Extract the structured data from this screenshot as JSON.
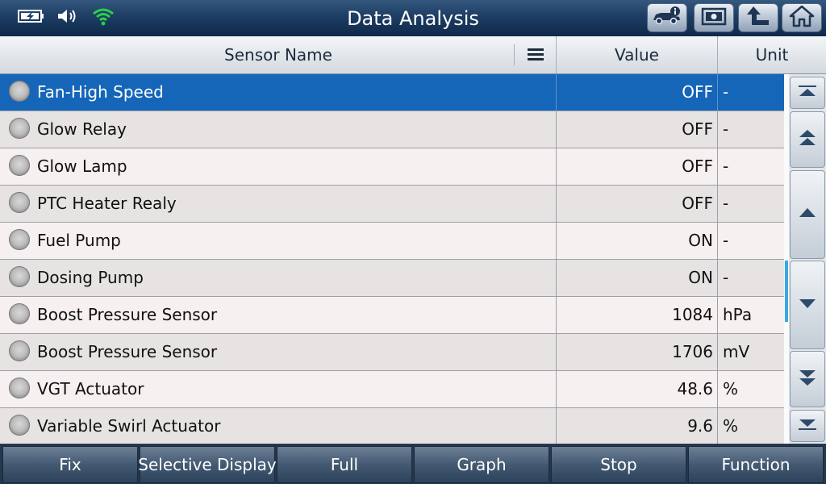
{
  "title": "Data Analysis",
  "status_icons": [
    "battery-charging-icon",
    "speaker-icon",
    "wifi-icon"
  ],
  "toolbar_icons": [
    "vehicle-info-icon",
    "screenshot-icon",
    "back-arrow-icon",
    "home-icon"
  ],
  "header": {
    "sensor_name": "Sensor Name",
    "value": "Value",
    "unit": "Unit",
    "menu_icon": "list-menu-icon"
  },
  "rows": [
    {
      "name": "Fan-High Speed",
      "value": "OFF",
      "unit": "-",
      "selected": true
    },
    {
      "name": "Glow Relay",
      "value": "OFF",
      "unit": "-"
    },
    {
      "name": "Glow Lamp",
      "value": "OFF",
      "unit": "-"
    },
    {
      "name": "PTC Heater Realy",
      "value": "OFF",
      "unit": "-"
    },
    {
      "name": "Fuel Pump",
      "value": "ON",
      "unit": "-"
    },
    {
      "name": "Dosing Pump",
      "value": "ON",
      "unit": "-"
    },
    {
      "name": "Boost Pressure Sensor",
      "value": "1084",
      "unit": "hPa"
    },
    {
      "name": "Boost Pressure Sensor",
      "value": "1706",
      "unit": "mV"
    },
    {
      "name": "VGT Actuator",
      "value": "48.6",
      "unit": "%"
    },
    {
      "name": "Variable Swirl Actuator",
      "value": "9.6",
      "unit": "%"
    }
  ],
  "scroll_buttons": [
    "scroll-top-icon",
    "page-up-icon",
    "line-up-icon",
    "line-down-icon",
    "page-down-icon",
    "scroll-bottom-icon"
  ],
  "bottom_buttons": [
    "Fix",
    "Selective Display",
    "Full",
    "Graph",
    "Stop",
    "Function"
  ],
  "colors": {
    "selected_row": "#1565b8",
    "title_bar": "#1d3d63",
    "scroll_thumb": "#3aa8e0",
    "wifi": "#2bd14a"
  }
}
